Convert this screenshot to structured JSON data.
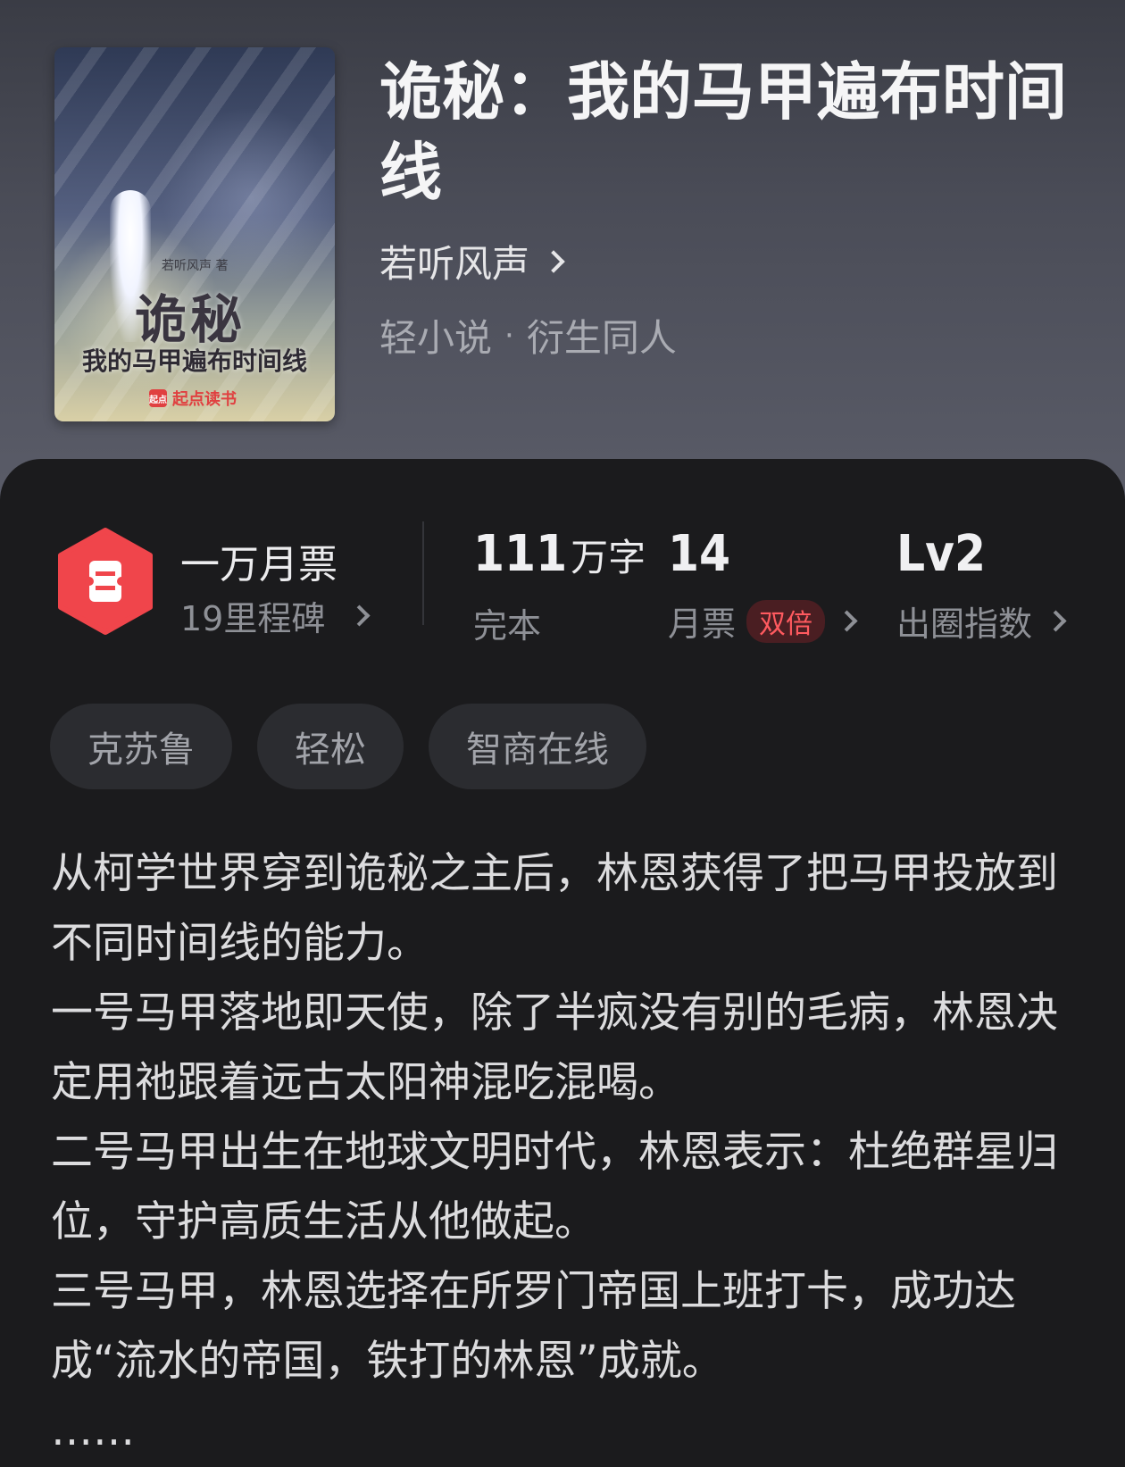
{
  "book": {
    "title": "诡秘：我的马甲遍布时间线",
    "author": "若听风声",
    "category": "轻小说",
    "subcategory": "衍生同人",
    "cover": {
      "author_text": "若听风声 著",
      "title_big": "诡秘",
      "title_small": "我的马甲遍布时间线",
      "brand": "起点读书",
      "brand_logo": "起点"
    }
  },
  "stats": {
    "votes_title": "一万月票",
    "votes_sub": "19里程碑",
    "words_value": "111",
    "words_unit": "万字",
    "status": "完本",
    "monthly_votes_value": "14",
    "monthly_votes_label": "月票",
    "double_badge": "双倍",
    "level_value": "Lv2",
    "level_label": "出圈指数"
  },
  "tags": [
    "克苏鲁",
    "轻松",
    "智商在线"
  ],
  "synopsis": [
    "从柯学世界穿到诡秘之主后，林恩获得了把马甲投放到不同时间线的能力。",
    "一号马甲落地即天使，除了半疯没有别的毛病，林恩决定用祂跟着远古太阳神混吃混喝。",
    "二号马甲出生在地球文明时代，林恩表示：杜绝群星归位，守护高质生活从他做起。",
    "三号马甲，林恩选择在所罗门帝国上班打卡，成功达成“流水的帝国，铁打的林恩”成就。",
    "……"
  ],
  "colors": {
    "header_top": "#3a3c45",
    "panel_bg": "#1b1b1d",
    "badge_red": "#f0454b",
    "double_text": "#ff5a5f"
  },
  "icons": {
    "ticket": "ticket-icon",
    "chevron": "chevron-right-icon"
  }
}
